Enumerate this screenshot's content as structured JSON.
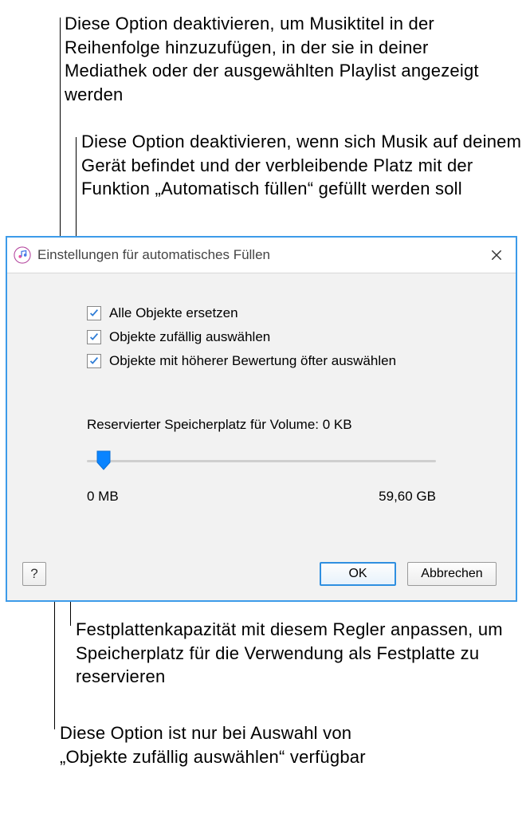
{
  "callouts": {
    "c1": "Diese Option deaktivieren, um Musiktitel in der Reihenfolge hinzuzufügen, in der sie in deiner Mediathek oder der ausgewählten Playlist angezeigt werden",
    "c2": "Diese Option deaktivieren, wenn sich Musik auf deinem Gerät befindet und der verbleibende Platz mit der Funktion „Automatisch füllen“ gefüllt werden soll",
    "c3": "Festplattenkapazität mit diesem Regler anpassen, um Speicherplatz für die Verwendung als Festplatte zu reservieren",
    "c4": "Diese Option ist nur bei Auswahl von „Objekte zufällig auswählen“ verfügbar"
  },
  "dialog": {
    "title": "Einstellungen für automatisches Füllen",
    "checks": [
      {
        "label": "Alle Objekte ersetzen"
      },
      {
        "label": "Objekte zufällig auswählen"
      },
      {
        "label": "Objekte mit höherer Bewertung öfter auswählen"
      }
    ],
    "reserved_label": "Reservierter Speicherplatz für Volume: 0 KB",
    "slider_min": "0 MB",
    "slider_max": "59,60 GB",
    "ok_label": "OK",
    "cancel_label": "Abbrechen",
    "help_label": "?"
  }
}
